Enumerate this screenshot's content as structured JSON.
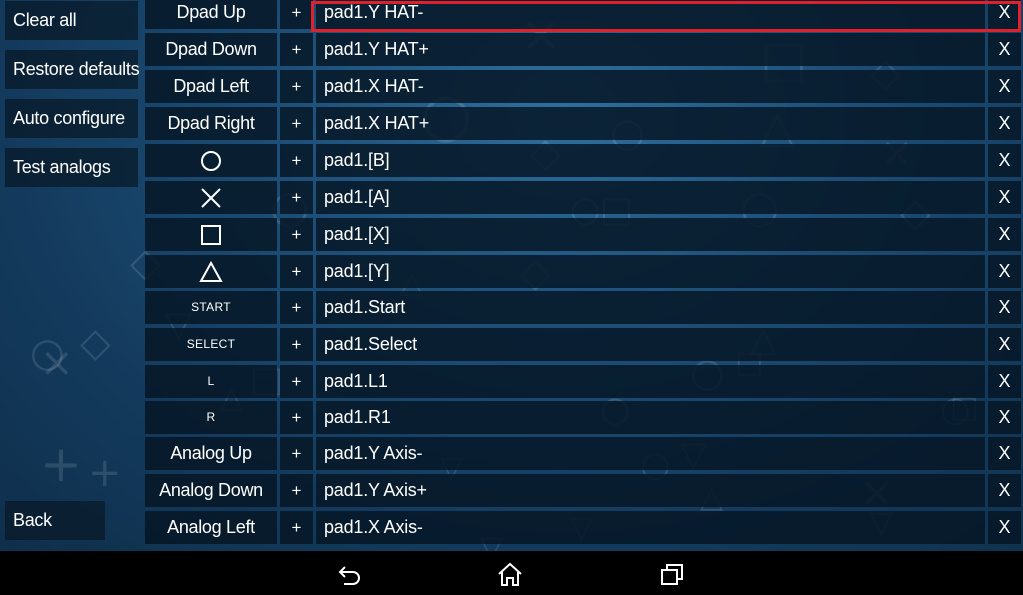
{
  "sidebar": {
    "buttons": [
      {
        "label": "Clear all"
      },
      {
        "label": "Restore defaults"
      },
      {
        "label": "Auto configure"
      },
      {
        "label": "Test analogs"
      }
    ],
    "back_label": "Back"
  },
  "mappings": [
    {
      "key": "Dpad Up",
      "plus": "+",
      "value": "pad1.Y HAT-",
      "remove": "X",
      "selected": true
    },
    {
      "key": "Dpad Down",
      "plus": "+",
      "value": "pad1.Y HAT+",
      "remove": "X"
    },
    {
      "key": "Dpad Left",
      "plus": "+",
      "value": "pad1.X HAT-",
      "remove": "X"
    },
    {
      "key": "Dpad Right",
      "plus": "+",
      "value": "pad1.X HAT+",
      "remove": "X"
    },
    {
      "icon": "circle-icon",
      "plus": "+",
      "value": "pad1.[B]",
      "remove": "X"
    },
    {
      "icon": "cross-icon",
      "plus": "+",
      "value": "pad1.[A]",
      "remove": "X"
    },
    {
      "icon": "square-icon",
      "plus": "+",
      "value": "pad1.[X]",
      "remove": "X"
    },
    {
      "icon": "triangle-icon",
      "plus": "+",
      "value": "pad1.[Y]",
      "remove": "X"
    },
    {
      "key": "START",
      "plus": "+",
      "value": "pad1.Start",
      "remove": "X"
    },
    {
      "key": "SELECT",
      "plus": "+",
      "value": "pad1.Select",
      "remove": "X"
    },
    {
      "key": "L",
      "plus": "+",
      "value": "pad1.L1",
      "remove": "X"
    },
    {
      "key": "R",
      "plus": "+",
      "value": "pad1.R1",
      "remove": "X"
    },
    {
      "key": "Analog Up",
      "plus": "+",
      "value": "pad1.Y Axis-",
      "remove": "X"
    },
    {
      "key": "Analog Down",
      "plus": "+",
      "value": "pad1.Y Axis+",
      "remove": "X"
    },
    {
      "key": "Analog Left",
      "plus": "+",
      "value": "pad1.X Axis-",
      "remove": "X"
    }
  ],
  "navbar": {
    "back_icon": "back-icon",
    "home_icon": "home-icon",
    "recents_icon": "recents-icon"
  },
  "colors": {
    "highlight": "#e0202a",
    "cell_bg": "#061626",
    "background": "#1d4f78"
  }
}
